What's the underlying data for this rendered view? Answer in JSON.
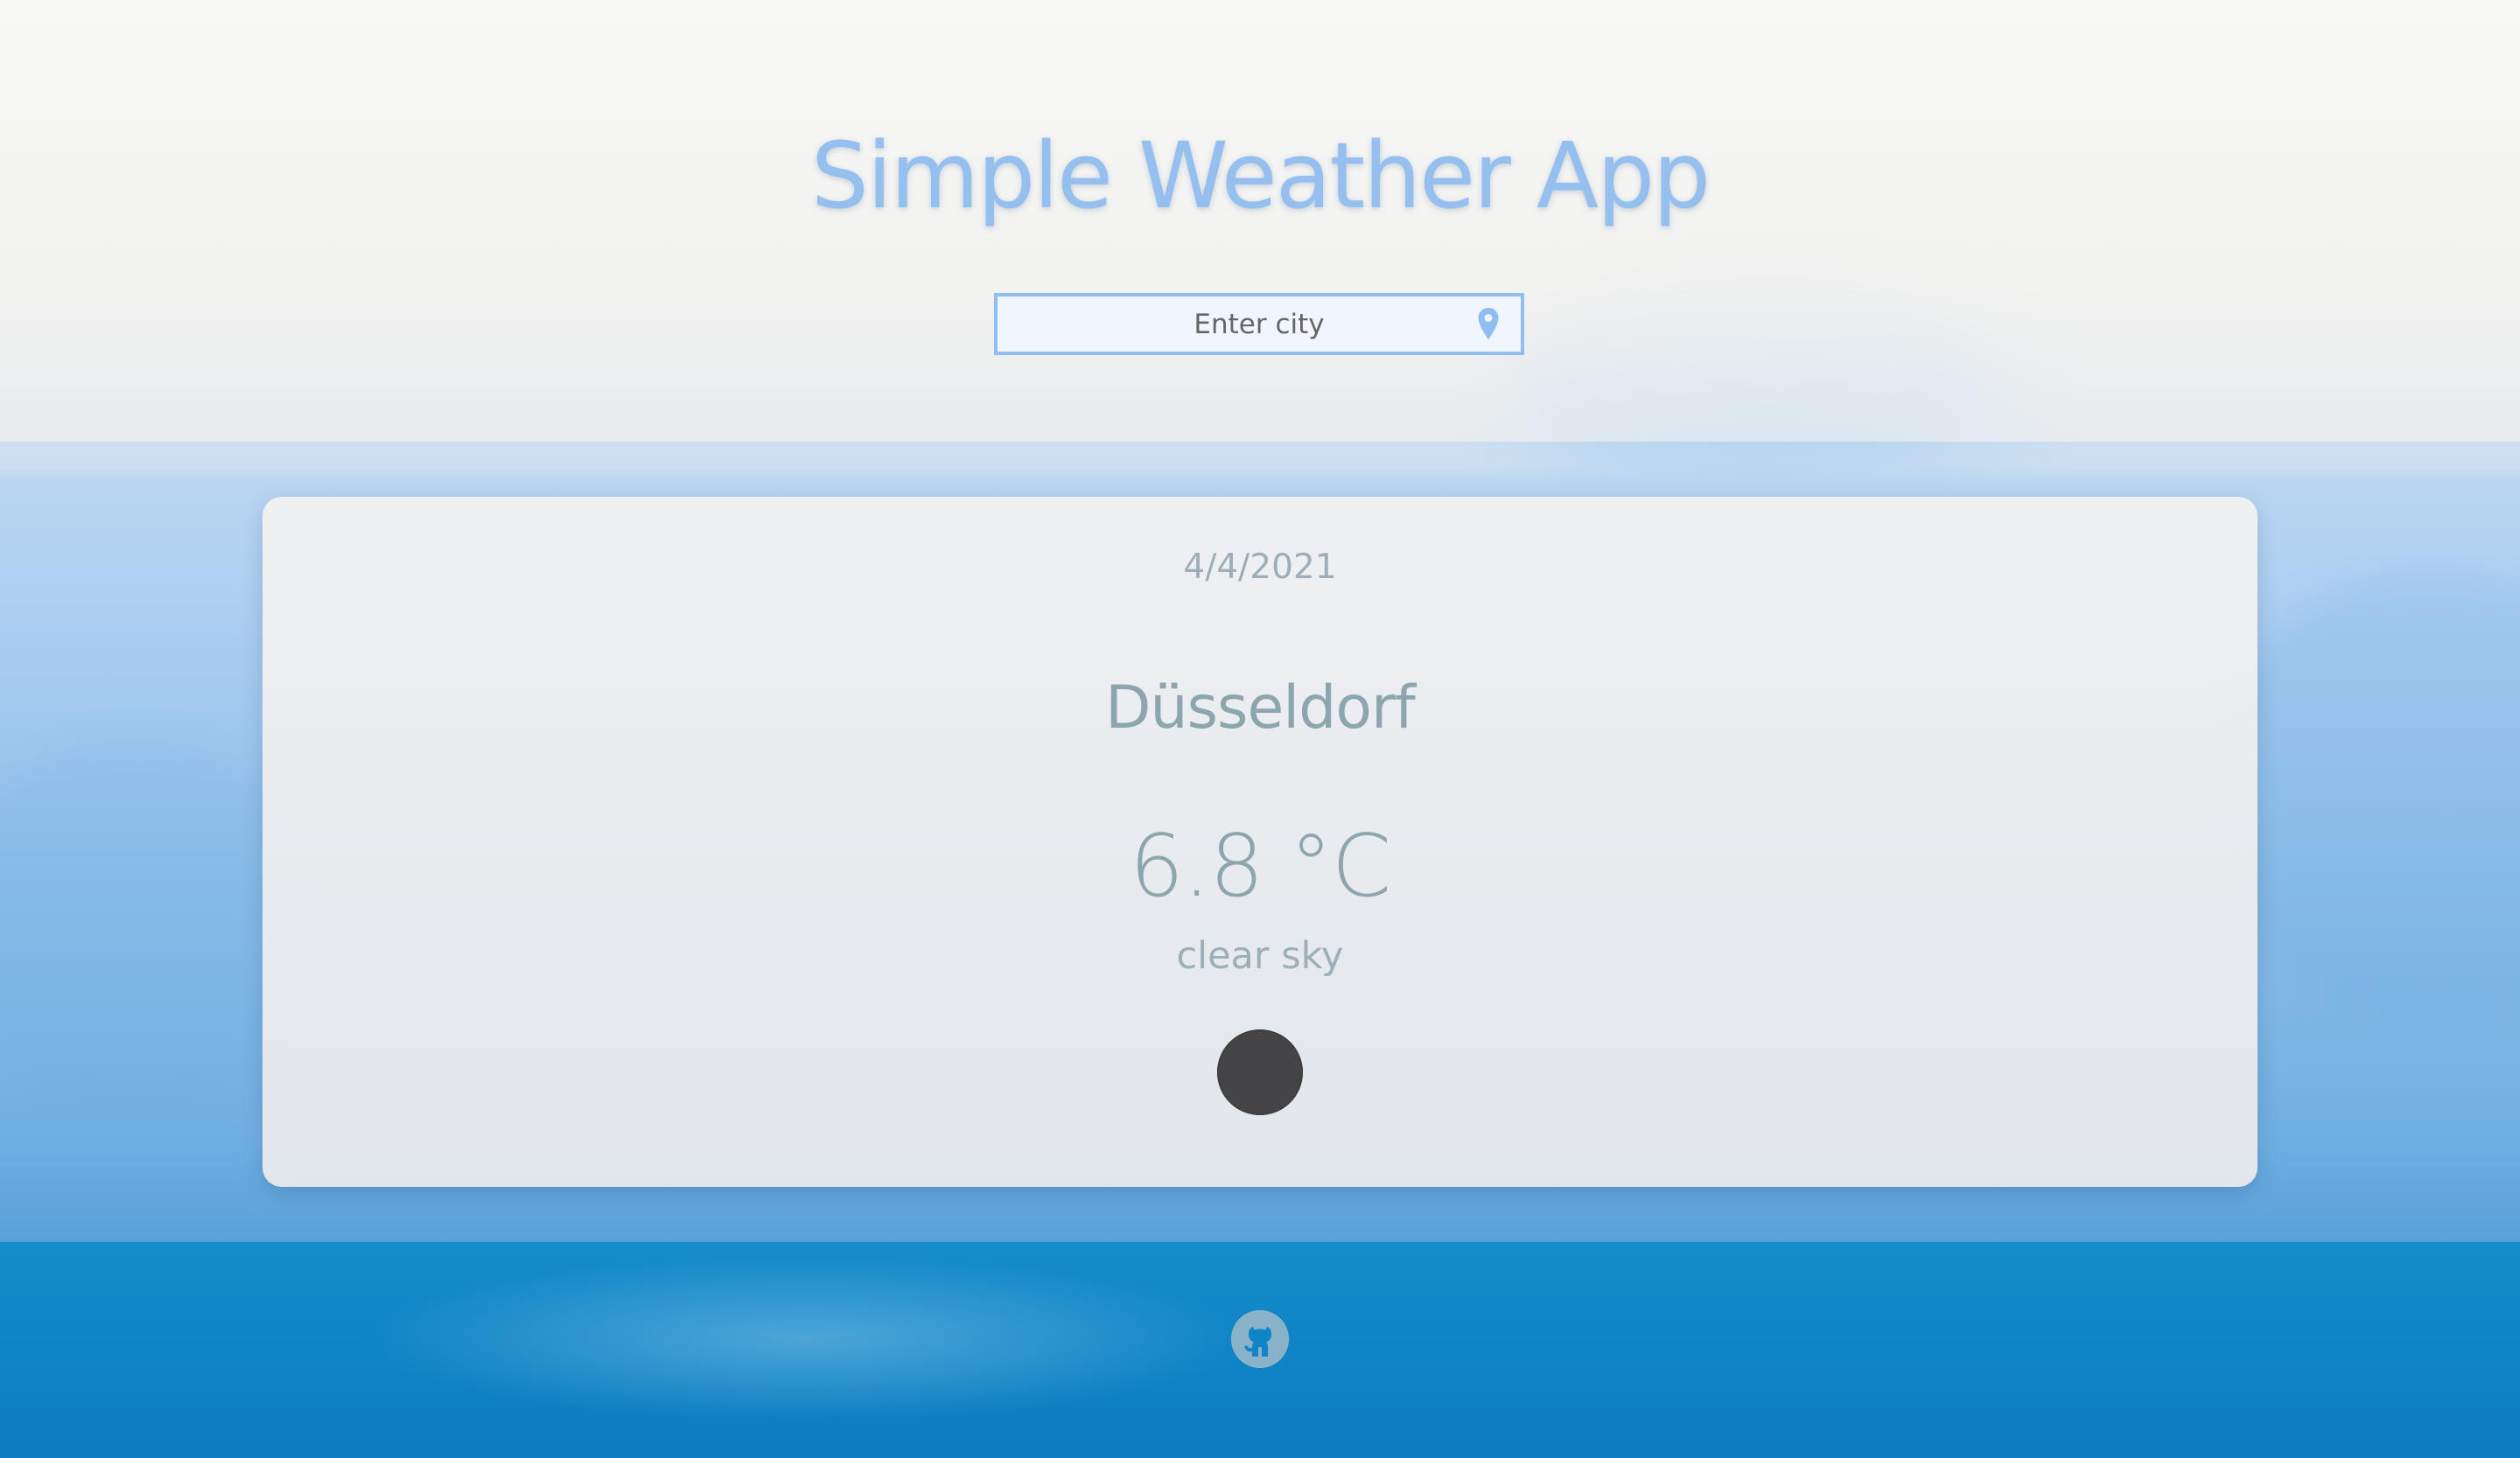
{
  "app": {
    "title": "Simple Weather App"
  },
  "search": {
    "placeholder": "Enter city",
    "value": "",
    "icon": "map-pin-icon"
  },
  "weather": {
    "date": "4/4/2021",
    "city": "Düsseldorf",
    "temperature": "6.8 °C",
    "description": "clear sky",
    "icon": "weather-icon"
  },
  "footer": {
    "icon": "github-icon"
  },
  "colors": {
    "title": "#94bfef",
    "search_border": "#8ebff0",
    "card_text": "#8da8ae",
    "weather_icon": "#444446",
    "footer_blue": "#0f85c6",
    "github_icon": "#8fb5c9"
  }
}
